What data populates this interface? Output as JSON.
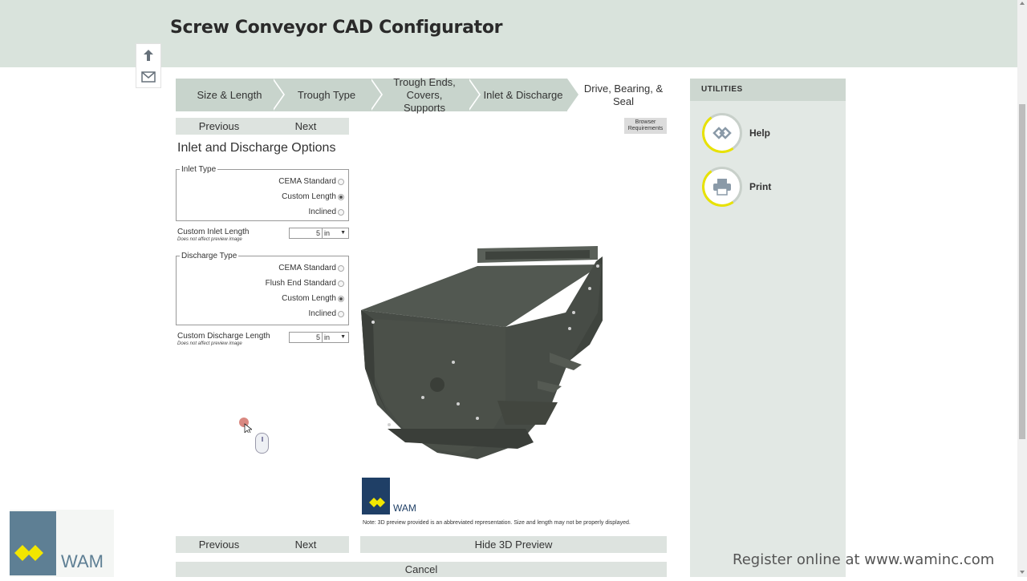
{
  "app": {
    "title": "Screw Conveyor CAD Configurator"
  },
  "side_tools": [
    {
      "name": "up-arrow-icon"
    },
    {
      "name": "envelope-icon"
    }
  ],
  "steps": [
    {
      "label": "Size & Length",
      "active": false
    },
    {
      "label": "Trough Type",
      "active": false
    },
    {
      "label": "Trough Ends, Covers, Supports",
      "active": false
    },
    {
      "label": "Inlet & Discharge",
      "active": false
    },
    {
      "label": "Drive, Bearing, & Seal",
      "active": true
    }
  ],
  "nav": {
    "previous": "Previous",
    "next": "Next"
  },
  "browser_requirements": "Browser Requirements",
  "section_title": "Inlet and Discharge Options",
  "inlet": {
    "legend": "Inlet Type",
    "options": [
      {
        "label": "CEMA Standard",
        "selected": false
      },
      {
        "label": "Custom Length",
        "selected": true
      },
      {
        "label": "Inclined",
        "selected": false
      }
    ],
    "length_label": "Custom Inlet Length",
    "length_note": "Does not affect preview image",
    "length_value": "5",
    "length_unit": "in"
  },
  "discharge": {
    "legend": "Discharge Type",
    "options": [
      {
        "label": "CEMA Standard",
        "selected": false
      },
      {
        "label": "Flush End Standard",
        "selected": false
      },
      {
        "label": "Custom Length",
        "selected": true
      },
      {
        "label": "Inclined",
        "selected": false
      }
    ],
    "length_label": "Custom Discharge Length",
    "length_note": "Does not affect preview image",
    "length_value": "5",
    "length_unit": "in"
  },
  "preview": {
    "logo_text": "WAM",
    "note": "Note: 3D preview provided is an abbreviated representation. Size and length may not be properly displayed.",
    "hide_button": "Hide 3D Preview"
  },
  "cancel": "Cancel",
  "utilities": {
    "title": "UTILITIES",
    "items": [
      {
        "label": "Help",
        "icon": "help-icon"
      },
      {
        "label": "Print",
        "icon": "printer-icon"
      }
    ]
  },
  "footer": {
    "logo_text": "WAM",
    "register": "Register online at www.waminc.com"
  },
  "colors": {
    "header_bg": "#d9e3dc",
    "step_bg": "#c8d4cc",
    "accent_yellow": "#e8e200",
    "logo_blue": "#1f3f66",
    "conveyor": "#4a5049"
  }
}
